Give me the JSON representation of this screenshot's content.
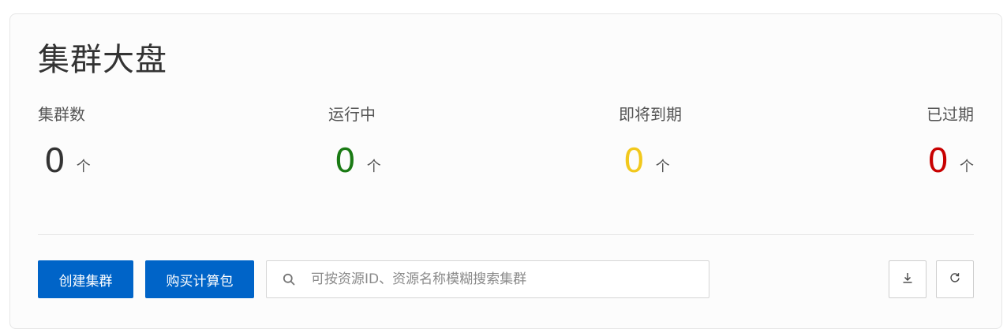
{
  "page": {
    "title": "集群大盘"
  },
  "stats": [
    {
      "label": "集群数",
      "value": "0",
      "unit": "个",
      "color": "#333333"
    },
    {
      "label": "运行中",
      "value": "0",
      "unit": "个",
      "color": "#1a7a14"
    },
    {
      "label": "即将到期",
      "value": "0",
      "unit": "个",
      "color": "#f2c81c"
    },
    {
      "label": "已过期",
      "value": "0",
      "unit": "个",
      "color": "#c80000"
    }
  ],
  "toolbar": {
    "create_label": "创建集群",
    "buy_label": "购买计算包",
    "search_placeholder": "可按资源ID、资源名称模糊搜索集群",
    "search_icon": "search-icon",
    "download_icon": "download-icon",
    "refresh_icon": "refresh-icon",
    "accent_color": "#0064c8"
  }
}
